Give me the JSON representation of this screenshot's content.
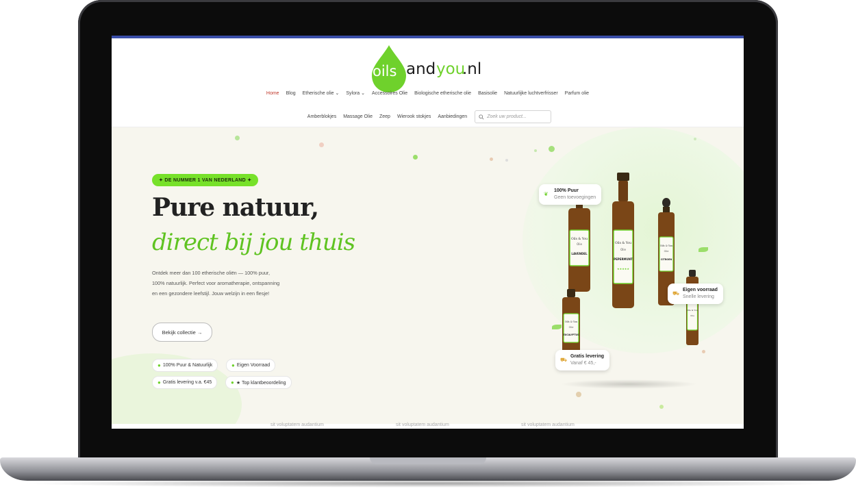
{
  "logo": {
    "oils": "oils",
    "and": "and",
    "you": "you",
    "nl": ".nl"
  },
  "nav": {
    "row1": [
      "Home",
      "Blog",
      "Etherische olie",
      "Sylora",
      "Accessoires Olie",
      "Biologische etherische olie",
      "Basisolie",
      "Natuurlijke luchtverfrisser",
      "Parfum olie"
    ],
    "row2": [
      "Amberblokjes",
      "Massage Olie",
      "Zeep",
      "Wierook stokjes",
      "Aanbiedingen"
    ],
    "dropdowns": [
      "Etherische olie",
      "Sylora"
    ],
    "active": "Home"
  },
  "search": {
    "placeholder": "Zoek uw product..."
  },
  "hero": {
    "badge": "✦ DE NUMMER 1 VAN NEDERLAND ✦",
    "title_line1": "Pure natuur,",
    "title_line2": "direct bij jou thuis",
    "description": "Ontdek meer dan 100 etherische oliën — 100% puur, 100% natuurlijk. Perfect voor aromatherapie, ontspanning en een gezondere leefstijl. Jouw welzijn in een flesje!",
    "cta": "Bekijk collectie →",
    "features": [
      "100% Puur & Natuurlijk",
      "Eigen Voorraad",
      "Gratis levering v.a. €45",
      "★ Top klantbeoordeling"
    ]
  },
  "cards": {
    "pure": {
      "title": "100% Puur",
      "sub": "Geen toevoegingen",
      "icon": "leaf-icon"
    },
    "stock": {
      "title": "Eigen voorraad",
      "sub": "Snelle levering",
      "icon": "truck-icon"
    },
    "delivery": {
      "title": "Gratis levering",
      "sub": "Vanaf € 45,-",
      "icon": "truck-icon"
    }
  },
  "bottles": [
    {
      "brand": "Oils & You",
      "sub": "Olie",
      "name": "LAVENDEL"
    },
    {
      "brand": "Oils & You",
      "sub": "Olie",
      "name": "PEPERMUNT"
    },
    {
      "brand": "Oils & You",
      "sub": "Olie",
      "name": "CITROEN"
    },
    {
      "brand": "Oils & You",
      "sub": "Olie",
      "name": "EUCALYPTUS"
    },
    {
      "brand": "Oils & You",
      "sub": "Olie",
      "name": ""
    }
  ],
  "footer_peek": [
    "sit voluptatem audantium",
    "sit voluptatem audantium",
    "sit voluptatem audantium"
  ],
  "colors": {
    "brand_green": "#6fd12c",
    "badge_green": "#77e12a",
    "active_nav": "#c0392b",
    "bottle_amber": "#7a4617"
  }
}
